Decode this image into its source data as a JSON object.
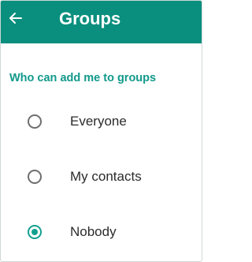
{
  "app_bar": {
    "title": "Groups",
    "back_icon": "arrow-left-icon",
    "color": "#0a8f7e"
  },
  "section": {
    "header": "Who can add me to groups",
    "accent_color": "#11998a"
  },
  "options": [
    {
      "label": "Everyone",
      "selected": false
    },
    {
      "label": "My contacts",
      "selected": false
    },
    {
      "label": "Nobody",
      "selected": true
    }
  ]
}
